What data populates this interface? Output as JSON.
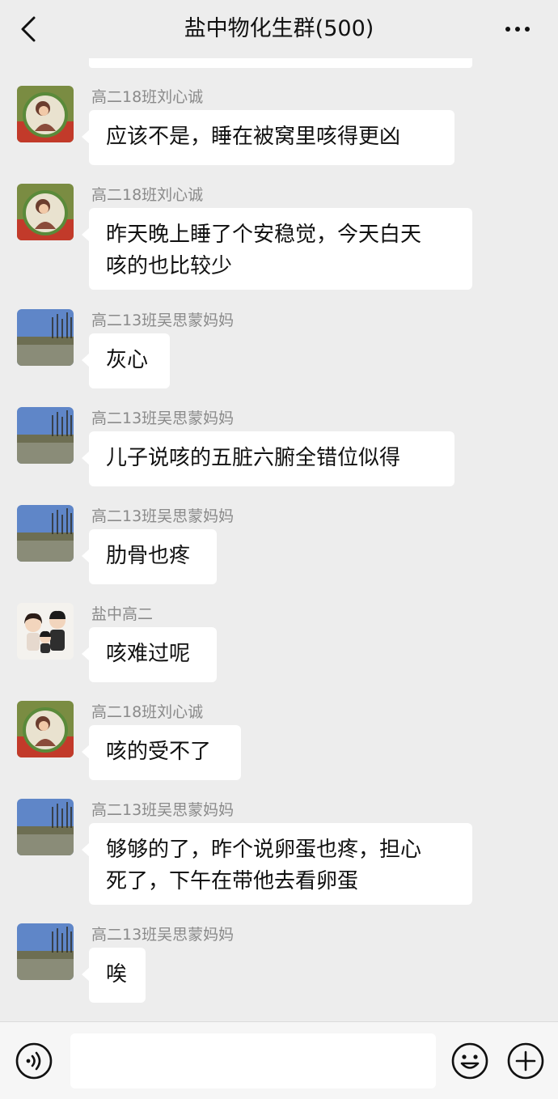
{
  "header": {
    "title": "盐中物化生群(500)",
    "back_icon": "chevron-left-icon",
    "more_icon": "more-dots-icon"
  },
  "messages": [
    {
      "sender": "高二18班刘心诚",
      "avatar": "portrait-avatar",
      "lines": [
        "应该不是，睡在被窝里咳得更凶"
      ]
    },
    {
      "sender": "高二18班刘心诚",
      "avatar": "portrait-avatar",
      "lines": [
        "昨天晚上睡了个安稳觉，今天白天",
        "咳的也比较少"
      ]
    },
    {
      "sender": "高二13班吴思蒙妈妈",
      "avatar": "lake-landscape-avatar",
      "lines": [
        "灰心"
      ]
    },
    {
      "sender": "高二13班吴思蒙妈妈",
      "avatar": "lake-landscape-avatar",
      "lines": [
        "儿子说咳的五脏六腑全错位似得"
      ]
    },
    {
      "sender": "高二13班吴思蒙妈妈",
      "avatar": "lake-landscape-avatar",
      "lines": [
        "肋骨也疼"
      ]
    },
    {
      "sender": "盐中高二",
      "avatar": "cartoon-family-avatar",
      "lines": [
        "咳难过呢"
      ]
    },
    {
      "sender": "高二18班刘心诚",
      "avatar": "portrait-avatar",
      "lines": [
        "咳的受不了"
      ]
    },
    {
      "sender": "高二13班吴思蒙妈妈",
      "avatar": "lake-landscape-avatar",
      "lines": [
        "够够的了，昨个说卵蛋也疼，担心",
        "死了，下午在带他去看卵蛋"
      ]
    },
    {
      "sender": "高二13班吴思蒙妈妈",
      "avatar": "lake-landscape-avatar",
      "lines": [
        "唉"
      ]
    }
  ],
  "input_bar": {
    "voice_icon": "voice-icon",
    "input_value": "",
    "emoji_icon": "emoji-icon",
    "plus_icon": "plus-icon"
  },
  "colors": {
    "background": "#ededed",
    "bubble": "#ffffff",
    "sender_text": "#8a8a8a"
  }
}
